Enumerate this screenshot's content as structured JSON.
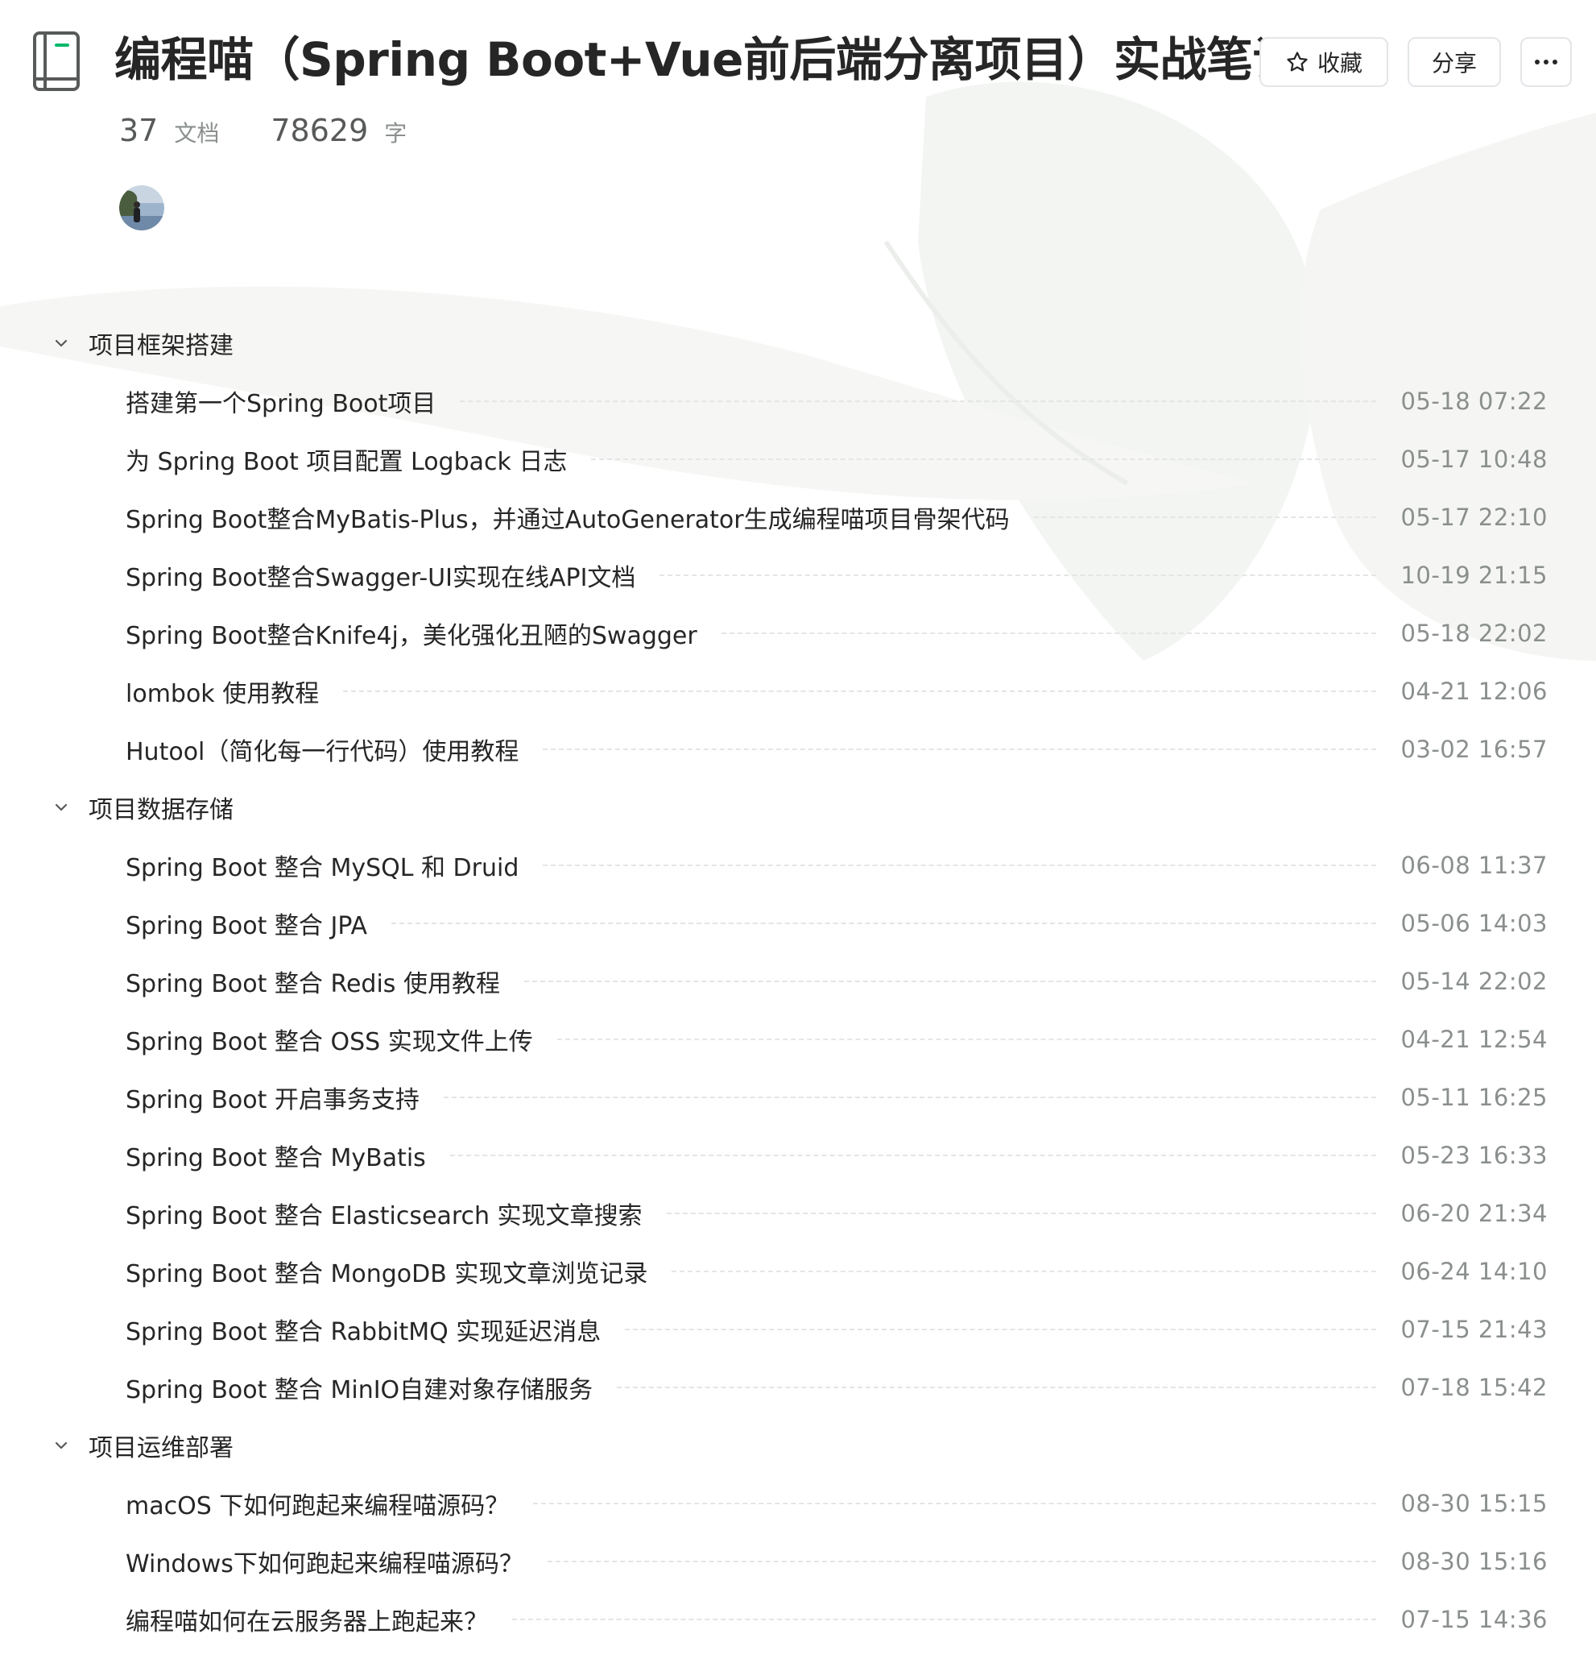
{
  "header": {
    "title": "编程喵（Spring Boot+Vue前后端分离项目）实战笔记",
    "icon": "book-icon",
    "actions": {
      "favorite_label": "收藏",
      "favorite_icon": "star-icon",
      "share_label": "分享",
      "more_icon": "more-horizontal-icon"
    }
  },
  "stats": {
    "doc_count": "37",
    "doc_unit": "文档",
    "word_count": "78629",
    "word_unit": "字"
  },
  "colors": {
    "text": "#262626",
    "muted": "#8a8f8d",
    "border": "#e3e5e8",
    "accent": "#00b96b"
  },
  "groups": [
    {
      "title": "项目框架搭建",
      "docs": [
        {
          "title": "搭建第一个Spring Boot项目",
          "time": "05-18 07:22"
        },
        {
          "title": "为 Spring Boot 项目配置 Logback 日志",
          "time": "05-17 10:48"
        },
        {
          "title": "Spring Boot整合MyBatis-Plus，并通过AutoGenerator生成编程喵项目骨架代码",
          "time": "05-17 22:10"
        },
        {
          "title": "Spring Boot整合Swagger-UI实现在线API文档",
          "time": "10-19 21:15"
        },
        {
          "title": "Spring Boot整合Knife4j，美化强化丑陋的Swagger",
          "time": "05-18 22:02"
        },
        {
          "title": "lombok 使用教程",
          "time": "04-21 12:06"
        },
        {
          "title": "Hutool（简化每一行代码）使用教程",
          "time": "03-02 16:57"
        }
      ]
    },
    {
      "title": "项目数据存储",
      "docs": [
        {
          "title": "Spring Boot 整合 MySQL 和 Druid",
          "time": "06-08 11:37"
        },
        {
          "title": "Spring Boot 整合 JPA",
          "time": "05-06 14:03"
        },
        {
          "title": "Spring Boot 整合 Redis 使用教程",
          "time": "05-14 22:02"
        },
        {
          "title": "Spring Boot 整合 OSS 实现文件上传",
          "time": "04-21 12:54"
        },
        {
          "title": "Spring Boot 开启事务支持",
          "time": "05-11 16:25"
        },
        {
          "title": "Spring Boot 整合 MyBatis",
          "time": "05-23 16:33"
        },
        {
          "title": "Spring Boot 整合 Elasticsearch 实现文章搜索",
          "time": "06-20 21:34"
        },
        {
          "title": "Spring Boot 整合 MongoDB 实现文章浏览记录",
          "time": "06-24 14:10"
        },
        {
          "title": "Spring Boot 整合 RabbitMQ 实现延迟消息",
          "time": "07-15 21:43"
        },
        {
          "title": "Spring Boot 整合 MinIO自建对象存储服务",
          "time": "07-18 15:42"
        }
      ]
    },
    {
      "title": "项目运维部署",
      "docs": [
        {
          "title": "macOS 下如何跑起来编程喵源码？",
          "time": "08-30 15:15"
        },
        {
          "title": "Windows下如何跑起来编程喵源码？",
          "time": "08-30 15:16"
        },
        {
          "title": "编程喵如何在云服务器上跑起来？",
          "time": "07-15 14:36"
        }
      ]
    }
  ]
}
